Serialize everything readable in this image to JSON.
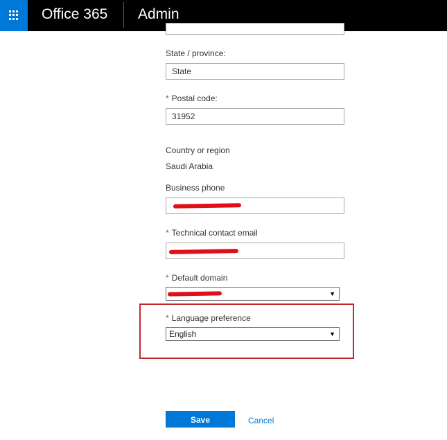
{
  "header": {
    "brand": "Office 365",
    "app_title": "Admin"
  },
  "form": {
    "state": {
      "label": "State / province:",
      "value": "State"
    },
    "postal": {
      "required_mark": "*",
      "label": "Postal code:",
      "value": "31952"
    },
    "country": {
      "label": "Country or region",
      "value": "Saudi Arabia"
    },
    "business_phone": {
      "label": "Business phone",
      "value": ""
    },
    "tech_email": {
      "required_mark": "*",
      "label": "Technical contact email",
      "value": ""
    },
    "default_domain": {
      "required_mark": "*",
      "label": "Default domain",
      "value": ""
    },
    "language": {
      "required_mark": "*",
      "label": "Language preference",
      "value": "English"
    }
  },
  "actions": {
    "save_label": "Save",
    "cancel_label": "Cancel"
  },
  "colors": {
    "accent": "#0078d7",
    "highlight": "#c4262e",
    "redaction": "#e0101a"
  }
}
